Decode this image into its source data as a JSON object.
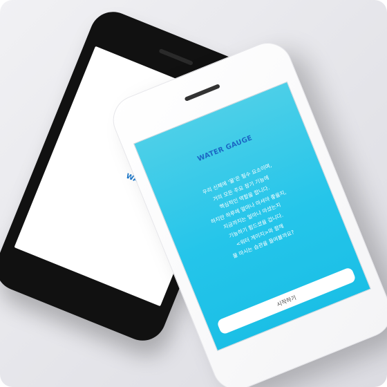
{
  "back_phone": {
    "title": "WATER GAUGE"
  },
  "front_phone": {
    "title": "WATER GAUGE",
    "description_lines": [
      "우리 신체에 '물'은 필수 요소이며,",
      "거의 모든 주요 장기 기능에",
      "핵심적인 역할을 합니다.",
      "하지만 하루에 얼마나 마셔야 좋을지,",
      "지금까지는 얼마나 마셨는지",
      "기능하기 힘드셨을 겁니다.",
      "<워터 게이지>와 함께",
      "물 마시는 습관을 들여볼까요?"
    ],
    "start_button_label": "시작하기"
  },
  "colors": {
    "accent_blue": "#1b67c4",
    "screen_cyan": "#25c5ea"
  }
}
